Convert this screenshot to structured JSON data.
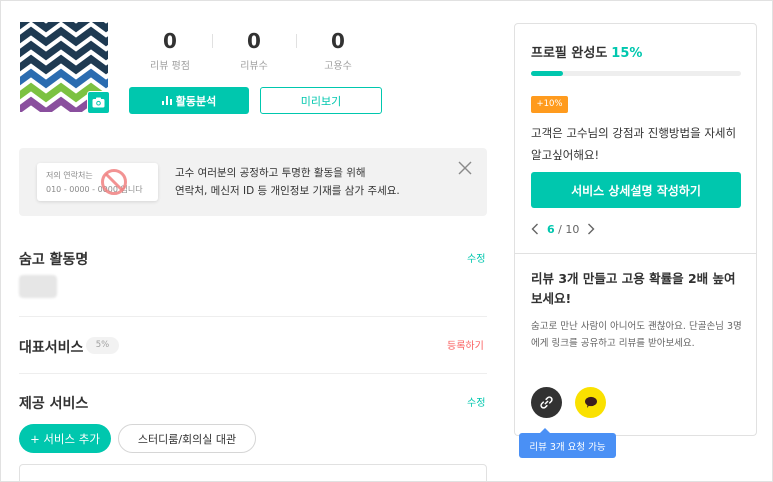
{
  "profile": {
    "stats": [
      {
        "value": "0",
        "label": "리뷰 평점"
      },
      {
        "value": "0",
        "label": "리뷰수"
      },
      {
        "value": "0",
        "label": "고용수"
      }
    ],
    "activity_button": "활동분석",
    "preview_button": "미리보기"
  },
  "notice": {
    "card_line1": "저의 연락처는",
    "card_line2": "010 - 0000 - 0000 입니다",
    "line1": "고수 여러분의 공정하고 투명한 활동을 위해",
    "line2": "연락처, 메신저 ID 등 개인정보 기재를 삼가 주세요."
  },
  "sections": {
    "activity_name": {
      "title": "숨고 활동명",
      "action": "수정"
    },
    "main_service": {
      "title": "대표서비스",
      "badge": "5%",
      "action": "등록하기"
    },
    "services": {
      "title": "제공 서비스",
      "action": "수정",
      "add_button": "+ 서비스 추가",
      "chip": "스터디룸/회의실 대관"
    }
  },
  "completion": {
    "title": "프로필 완성도",
    "percent_label": "15%",
    "progress_value": 0.15,
    "bonus": "+10%",
    "description": "고객은 고수님의 강점과 진행방법을 자세히 알고싶어해요!",
    "button": "서비스 상세설명 작성하기",
    "pager_current": "6",
    "pager_sep": "/",
    "pager_total": "10"
  },
  "review": {
    "title": "리뷰 3개 만들고 고용 확률을 2배 높여보세요!",
    "description": "숨고로 만난 사람이 아니어도 괜찮아요. 단골손님 3명에게 링크를 공유하고 리뷰를 받아보세요.",
    "tooltip": "리뷰 3개 요청 가능"
  },
  "colors": {
    "accent": "#00c7ae",
    "warning": "#fa5f5f",
    "bonus": "#ff9b1e",
    "tooltip": "#4a90f5",
    "kakao": "#fae100"
  },
  "icons": [
    "camera-icon",
    "bar-chart-icon",
    "no-sign-icon",
    "close-icon",
    "chevron-left-icon",
    "chevron-right-icon",
    "link-icon",
    "kakao-icon"
  ]
}
